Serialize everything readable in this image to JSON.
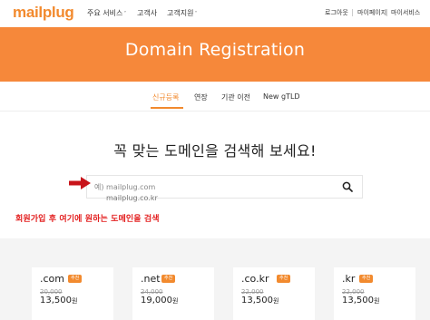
{
  "nav": {
    "logo": "mailplug",
    "items": [
      {
        "label": "주요 서비스",
        "has_dropdown": true
      },
      {
        "label": "고객사",
        "has_dropdown": false
      },
      {
        "label": "고객지원",
        "has_dropdown": true
      }
    ],
    "utility": [
      "로그아웃",
      "마이페이지",
      "마이서비스"
    ]
  },
  "hero": {
    "title": "Domain Registration",
    "background_color": "#f6883a"
  },
  "tabs": {
    "items": [
      "신규등록",
      "연장",
      "기관 이전",
      "New gTLD"
    ],
    "active_index": 0,
    "accent_color": "#f28a2e"
  },
  "search": {
    "headline": "꼭 맞는 도메인을 검색해 보세요!",
    "placeholder": "예) mailplug.com",
    "suggestion": "mailplug.co.kr",
    "icon": "search-icon"
  },
  "annotation": {
    "text": "회원가입 후 여기에 원하는 도메인을 검색",
    "color": "#e32020"
  },
  "pricing": {
    "badge_label": "추천",
    "currency_suffix": "원",
    "cards": [
      {
        "tld": ".com",
        "old_price": "20,000",
        "price": "13,500"
      },
      {
        "tld": ".net",
        "old_price": "24,000",
        "price": "19,000"
      },
      {
        "tld": ".co.kr",
        "old_price": "22,000",
        "price": "13,500"
      },
      {
        "tld": ".kr",
        "old_price": "22,000",
        "price": "13,500"
      }
    ]
  }
}
